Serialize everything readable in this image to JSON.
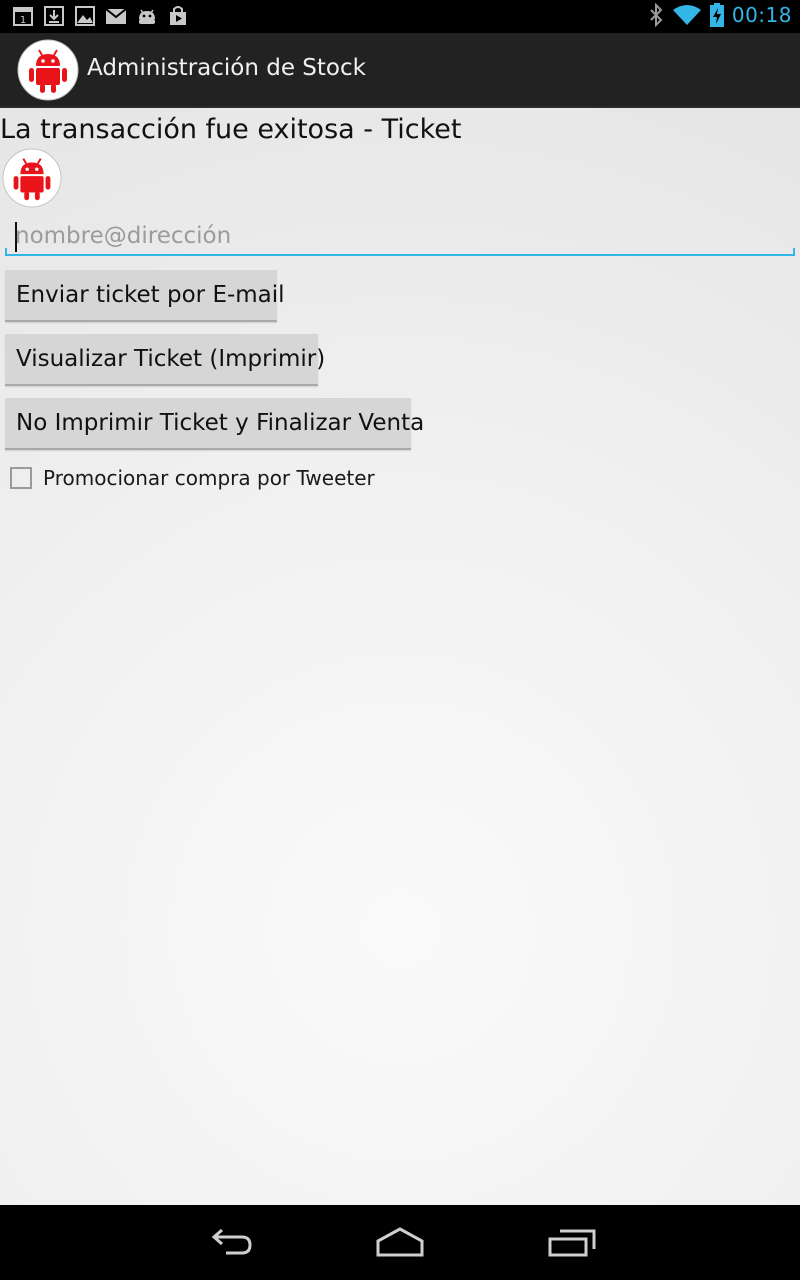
{
  "status_bar": {
    "time": "00:18",
    "colors": {
      "accent": "#33b5e5",
      "icon": "#c8c8c8"
    },
    "notification_icons": [
      "calendar-icon",
      "download-icon",
      "gallery-icon",
      "gmail-icon",
      "android-debug-icon",
      "play-store-icon"
    ],
    "system_icons": [
      "bluetooth-icon",
      "wifi-icon",
      "battery-charging-icon"
    ]
  },
  "action_bar": {
    "title": "Administración de Stock",
    "icon": "android-robot-icon"
  },
  "main": {
    "heading": "La transacción fue exitosa - Ticket",
    "email_field": {
      "value": "",
      "placeholder": "nombre@dirección"
    },
    "buttons": {
      "send_email": "Enviar ticket por E-mail",
      "view_ticket": "Visualizar Ticket (Imprimir)",
      "no_print": "No Imprimir Ticket y Finalizar Venta"
    },
    "tweet_checkbox": {
      "label": "Promocionar compra por Tweeter",
      "checked": false
    }
  },
  "nav_bar": {
    "icons": [
      "back-icon",
      "home-icon",
      "recent-apps-icon"
    ]
  }
}
